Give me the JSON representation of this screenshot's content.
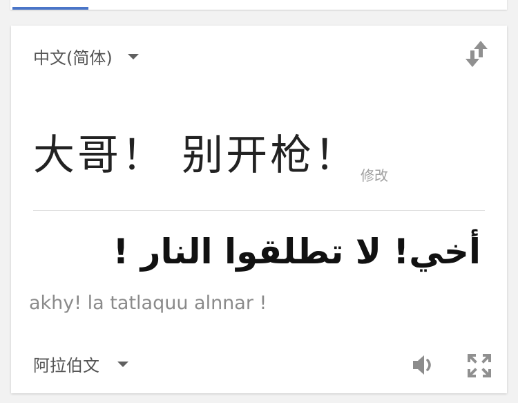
{
  "colors": {
    "accent": "#4a75c8",
    "icon": "#909090",
    "muted_text": "#8a8a8a"
  },
  "source": {
    "language": "中文(简体)",
    "text": "大哥！ 别开枪！",
    "edit_label": "修改"
  },
  "target": {
    "language": "阿拉伯文",
    "text": "أخي! لا تطلقوا النار !",
    "transliteration": "akhy! la tatlaquu alnnar !"
  },
  "icons": {
    "swap": "swap-languages-icon",
    "speaker": "speaker-icon",
    "fullscreen": "fullscreen-icon",
    "dropdown": "chevron-down-icon"
  }
}
